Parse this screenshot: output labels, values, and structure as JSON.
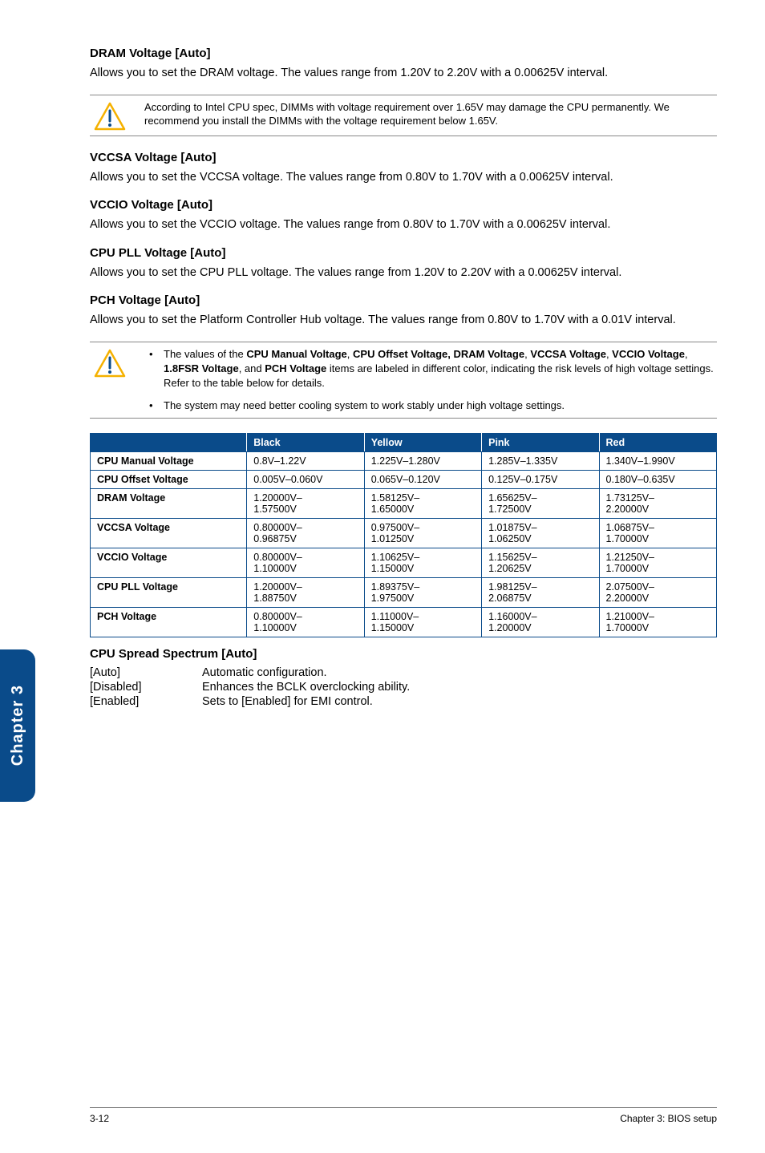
{
  "sections": {
    "dram": {
      "title": "DRAM Voltage [Auto]",
      "body": "Allows you to set the DRAM voltage. The values range from 1.20V to 2.20V with a 0.00625V interval."
    },
    "dram_note": "According to Intel CPU spec, DIMMs with voltage requirement over 1.65V may damage the CPU permanently. We recommend you install the DIMMs with the voltage requirement below 1.65V.",
    "vccsa": {
      "title": "VCCSA Voltage [Auto]",
      "body": "Allows you to set the VCCSA voltage. The values range from 0.80V to 1.70V with a 0.00625V interval."
    },
    "vccio": {
      "title": "VCCIO Voltage [Auto]",
      "body": "Allows you to set the VCCIO voltage. The values range from 0.80V to 1.70V with a 0.00625V interval."
    },
    "cpupll": {
      "title": "CPU PLL Voltage [Auto]",
      "body": "Allows you to set the CPU PLL voltage. The values range from 1.20V to 2.20V with a 0.00625V interval."
    },
    "pch": {
      "title": "PCH Voltage [Auto]",
      "body": "Allows you to set the Platform Controller Hub voltage. The values range from 0.80V to 1.70V with a 0.01V interval."
    },
    "bullet1_pre": "The values of the ",
    "bullet1_b1": "CPU Manual Voltage",
    "bullet1_s1": ", ",
    "bullet1_b2": "CPU Offset Voltage, DRAM Voltage",
    "bullet1_s2": ", ",
    "bullet1_b3": "VCCSA Voltage",
    "bullet1_s3": ", ",
    "bullet1_b4": "VCCIO Voltage",
    "bullet1_s4": ", ",
    "bullet1_b5": "1.8FSR Voltage",
    "bullet1_s5": ", and ",
    "bullet1_b6": "PCH Voltage",
    "bullet1_post": " items are labeled in different color, indicating the risk levels of high voltage settings. Refer to the table below for details.",
    "bullet2": "The system may need better cooling system to work stably under high voltage settings.",
    "spread": {
      "title": "CPU Spread Spectrum [Auto]",
      "opts": [
        {
          "k": "[Auto]",
          "v": "Automatic configuration."
        },
        {
          "k": "[Disabled]",
          "v": "Enhances the BCLK overclocking ability."
        },
        {
          "k": "[Enabled]",
          "v": "Sets to [Enabled] for EMI control."
        }
      ]
    }
  },
  "table": {
    "headers": [
      "",
      "Black",
      "Yellow",
      "Pink",
      "Red"
    ],
    "rows": [
      {
        "label": "CPU Manual Voltage",
        "cells": [
          "0.8V–1.22V",
          "1.225V–1.280V",
          "1.285V–1.335V",
          "1.340V–1.990V"
        ]
      },
      {
        "label": "CPU Offset Voltage",
        "cells": [
          "0.005V–0.060V",
          "0.065V–0.120V",
          "0.125V–0.175V",
          "0.180V–0.635V"
        ]
      },
      {
        "label": "DRAM Voltage",
        "cells": [
          "1.20000V–1.57500V",
          "1.58125V–1.65000V",
          "1.65625V–1.72500V",
          "1.73125V–2.20000V"
        ]
      },
      {
        "label": "VCCSA Voltage",
        "cells": [
          "0.80000V–0.96875V",
          "0.97500V–1.01250V",
          "1.01875V–1.06250V",
          "1.06875V–1.70000V"
        ]
      },
      {
        "label": "VCCIO Voltage",
        "cells": [
          "0.80000V–1.10000V",
          "1.10625V–1.15000V",
          "1.15625V–1.20625V",
          "1.21250V–1.70000V"
        ]
      },
      {
        "label": "CPU PLL Voltage",
        "cells": [
          "1.20000V–1.88750V",
          "1.89375V–1.97500V",
          "1.98125V–2.06875V",
          "2.07500V–2.20000V"
        ]
      },
      {
        "label": "PCH Voltage",
        "cells": [
          "0.80000V–1.10000V",
          "1.11000V–1.15000V",
          "1.16000V–1.20000V",
          "1.21000V–1.70000V"
        ]
      }
    ]
  },
  "sidebar": "Chapter 3",
  "footer": {
    "left": "3-12",
    "right": "Chapter 3: BIOS setup"
  }
}
